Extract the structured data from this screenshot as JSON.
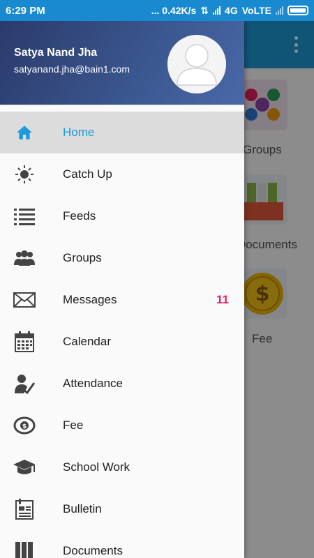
{
  "status_bar": {
    "time": "6:29 PM",
    "net_speed": "... 0.42K/s",
    "network": "4G",
    "volte": "VoLTE"
  },
  "background": {
    "tiles": [
      "Groups",
      "Documents",
      "Fee"
    ]
  },
  "drawer": {
    "user_name": "Satya Nand Jha",
    "user_email": "satyanand.jha@bain1.com",
    "items": [
      {
        "label": "Home",
        "icon": "home-icon",
        "active": true
      },
      {
        "label": "Catch Up",
        "icon": "sun-icon"
      },
      {
        "label": "Feeds",
        "icon": "list-icon"
      },
      {
        "label": "Groups",
        "icon": "people-icon"
      },
      {
        "label": "Messages",
        "icon": "envelope-icon",
        "badge": "11"
      },
      {
        "label": "Calendar",
        "icon": "calendar-icon"
      },
      {
        "label": "Attendance",
        "icon": "attendance-icon"
      },
      {
        "label": "Fee",
        "icon": "money-icon"
      },
      {
        "label": "School Work",
        "icon": "graduation-cap-icon"
      },
      {
        "label": "Bulletin",
        "icon": "bulletin-icon"
      },
      {
        "label": "Documents",
        "icon": "documents-icon"
      }
    ]
  },
  "colors": {
    "accent": "#1e9ad8",
    "badge": "#e91e63",
    "header_start": "#2b3a6b",
    "header_end": "#4a68a8"
  }
}
